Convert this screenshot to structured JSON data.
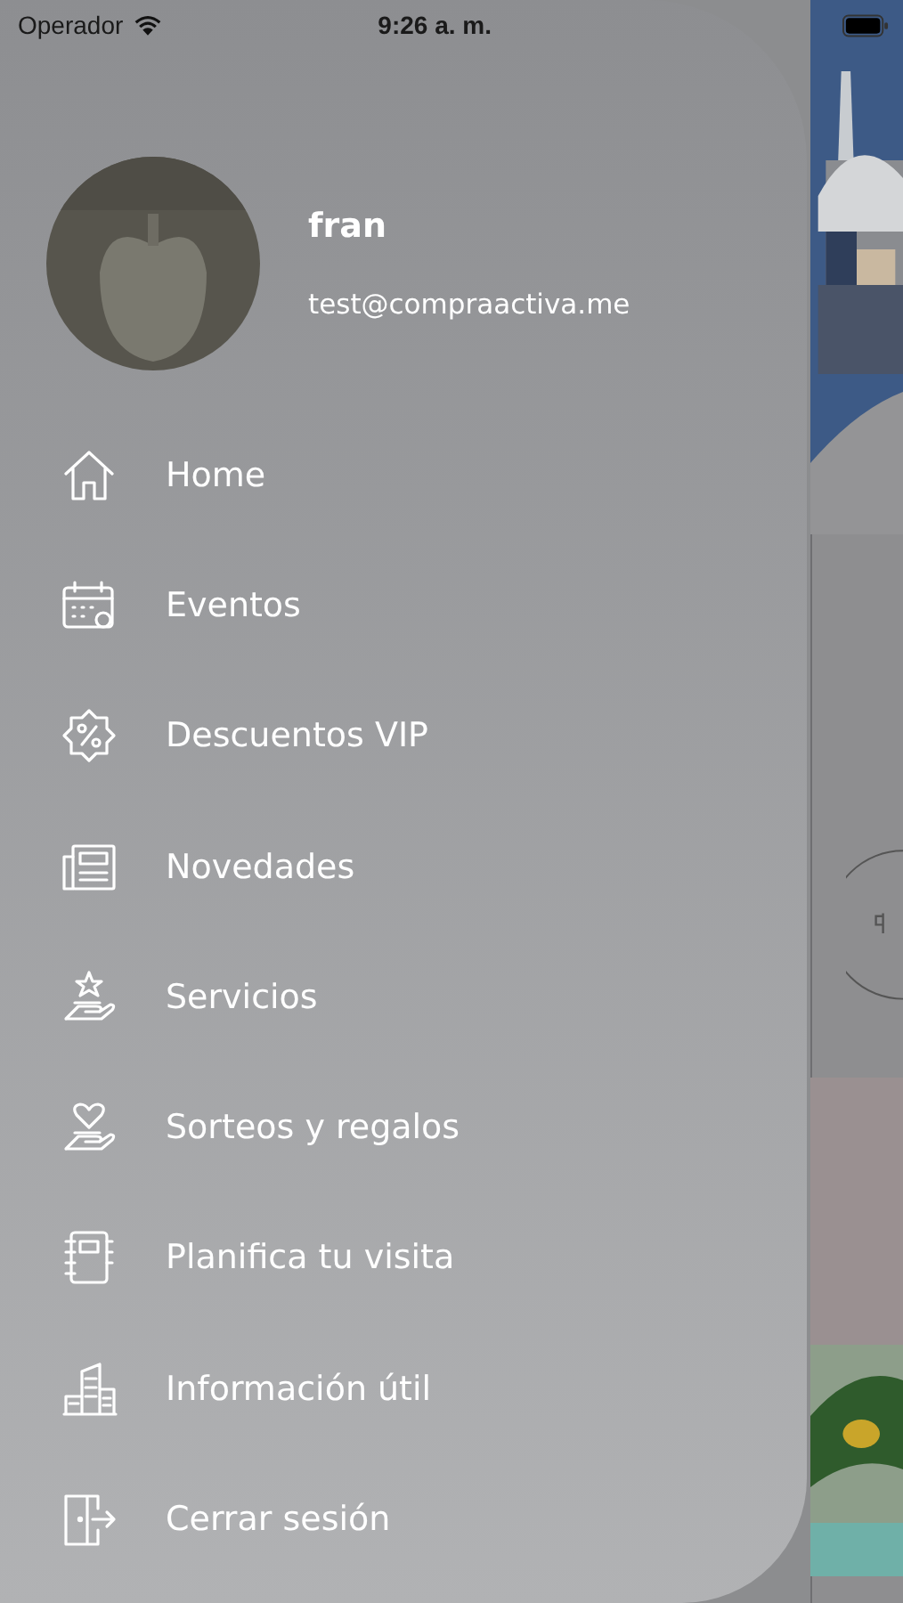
{
  "status_bar": {
    "carrier": "Operador",
    "time": "9:26 a. m."
  },
  "profile": {
    "name": "fran",
    "email": "test@compraactiva.me"
  },
  "menu": [
    {
      "label": "Home"
    },
    {
      "label": "Eventos"
    },
    {
      "label": "Descuentos VIP"
    },
    {
      "label": "Novedades"
    },
    {
      "label": "Servicios"
    },
    {
      "label": "Sorteos y regalos"
    },
    {
      "label": "Planifica tu visita"
    },
    {
      "label": "Información útil"
    },
    {
      "label": "Cerrar sesión"
    }
  ]
}
